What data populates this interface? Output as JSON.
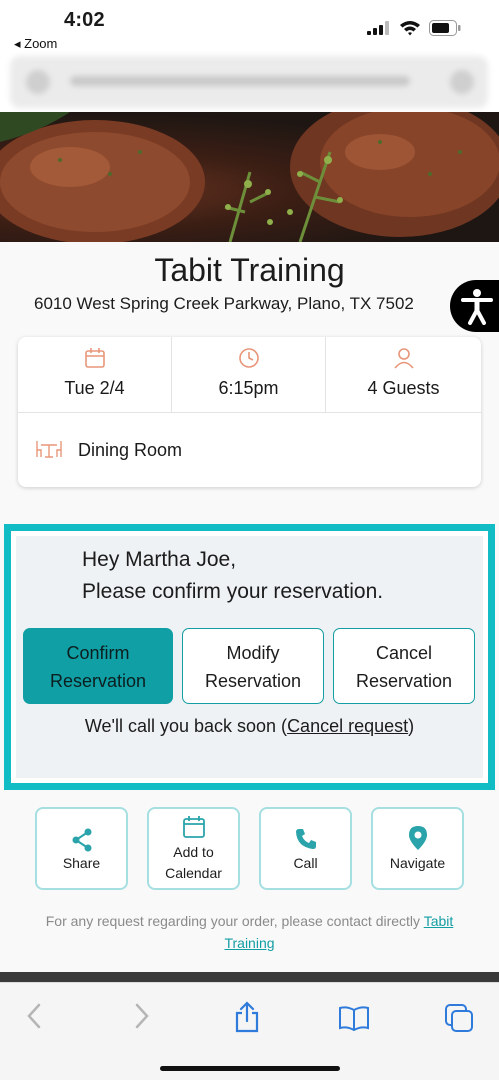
{
  "status": {
    "time": "4:02",
    "back_label": "◂ Zoom"
  },
  "restaurant": {
    "name": "Tabit Training",
    "address": "6010 West Spring Creek Parkway, Plano, TX 7502"
  },
  "reservation": {
    "date": "Tue 2/4",
    "time": "6:15pm",
    "guests": "4 Guests",
    "area": "Dining Room"
  },
  "confirm": {
    "greeting": "Hey Martha Joe,",
    "prompt": "Please confirm your reservation.",
    "confirm_l1": "Confirm",
    "confirm_l2": "Reservation",
    "modify_l1": "Modify",
    "modify_l2": "Reservation",
    "cancel_l1": "Cancel",
    "cancel_l2": "Reservation",
    "callback_text": "We'll call you back soon (",
    "callback_link": "Cancel request",
    "callback_end": ")"
  },
  "actions": {
    "share": "Share",
    "calendar_l1": "Add to",
    "calendar_l2": "Calendar",
    "call": "Call",
    "navigate": "Navigate"
  },
  "footer": {
    "text": "For any request regarding your order, please contact directly ",
    "link_l1": "Tabit",
    "link_l2": "Training"
  },
  "colors": {
    "accent": "#12bcc4",
    "primary_button": "#109fa4",
    "icon_accent": "#e8967a",
    "action_icon": "#2aa4aa"
  }
}
